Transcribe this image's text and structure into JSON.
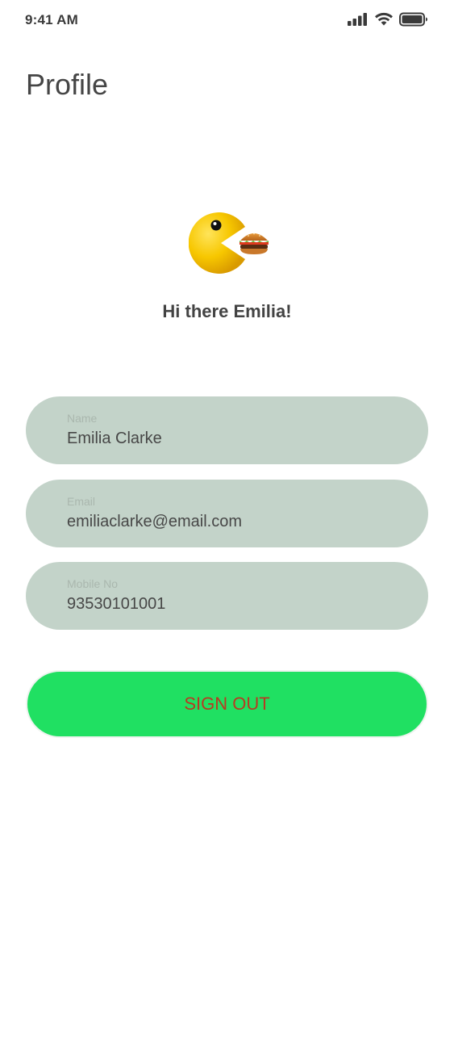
{
  "status_bar": {
    "time": "9:41 AM",
    "icons": [
      "signal-icon",
      "wifi-icon",
      "battery-icon"
    ]
  },
  "page": {
    "title": "Profile"
  },
  "profile": {
    "avatar_icon": "pacman-burger-icon",
    "greeting": "Hi there Emilia!"
  },
  "fields": {
    "name": {
      "label": "Name",
      "value": "Emilia Clarke"
    },
    "email": {
      "label": "Email",
      "value": "emiliaclarke@email.com"
    },
    "mobile": {
      "label": "Mobile No",
      "value": "93530101001"
    }
  },
  "actions": {
    "sign_out_label": "SIGN OUT"
  },
  "colors": {
    "field_background": "#c3d3c9",
    "button_background": "#20e062",
    "button_text": "#b83a22",
    "pacman_yellow": "#f7c700"
  }
}
